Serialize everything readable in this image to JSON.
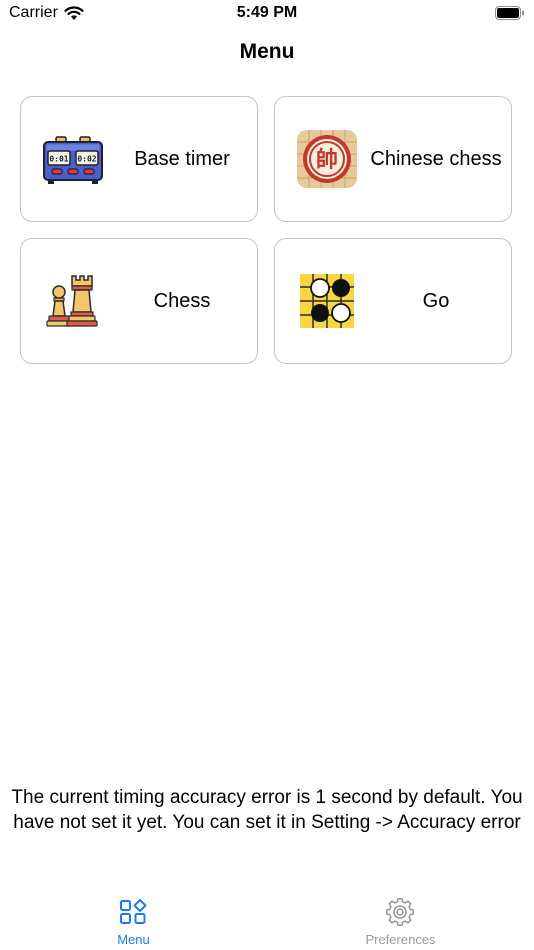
{
  "status_bar": {
    "carrier": "Carrier",
    "time": "5:49 PM"
  },
  "nav": {
    "title": "Menu"
  },
  "cards": [
    {
      "label": "Base timer",
      "icon": "chess-clock-icon"
    },
    {
      "label": "Chinese chess",
      "icon": "xiangqi-piece-icon"
    },
    {
      "label": "Chess",
      "icon": "chess-pieces-icon"
    },
    {
      "label": "Go",
      "icon": "go-board-icon"
    }
  ],
  "footer": {
    "note": "The current timing accuracy error is 1 second by default. You have not set it yet. You can set it in Setting -> Accuracy error"
  },
  "tabs": [
    {
      "label": "Menu",
      "icon": "grid-icon",
      "selected": true
    },
    {
      "label": "Preferences",
      "icon": "gear-icon",
      "selected": false
    }
  ],
  "colors": {
    "accent": "#1a7cf2",
    "inactive": "#9a9a9a",
    "card_border": "#c4c4c4"
  }
}
